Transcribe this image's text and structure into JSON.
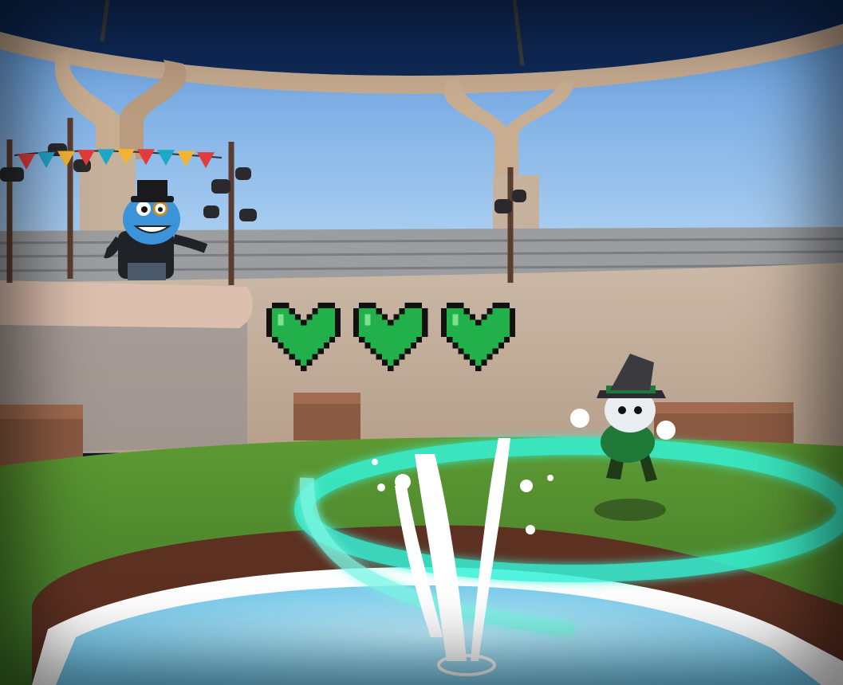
{
  "hud": {
    "health": {
      "current": 3,
      "max": 3,
      "icon": "pixel-heart-icon",
      "color": "#22b04a"
    }
  },
  "scene": {
    "sky_color": "#8fc1ee",
    "grass_color": "#4e8a2e",
    "water_color": "#7fd3f2",
    "ring_color": "#34f2d6",
    "bunting_colors": [
      "#e23b3b",
      "#1fa7c8",
      "#f2b531",
      "#e23b3b",
      "#1fa7c8",
      "#f2b531",
      "#e23b3b",
      "#1fa7c8",
      "#f2b531",
      "#e23b3b"
    ]
  }
}
